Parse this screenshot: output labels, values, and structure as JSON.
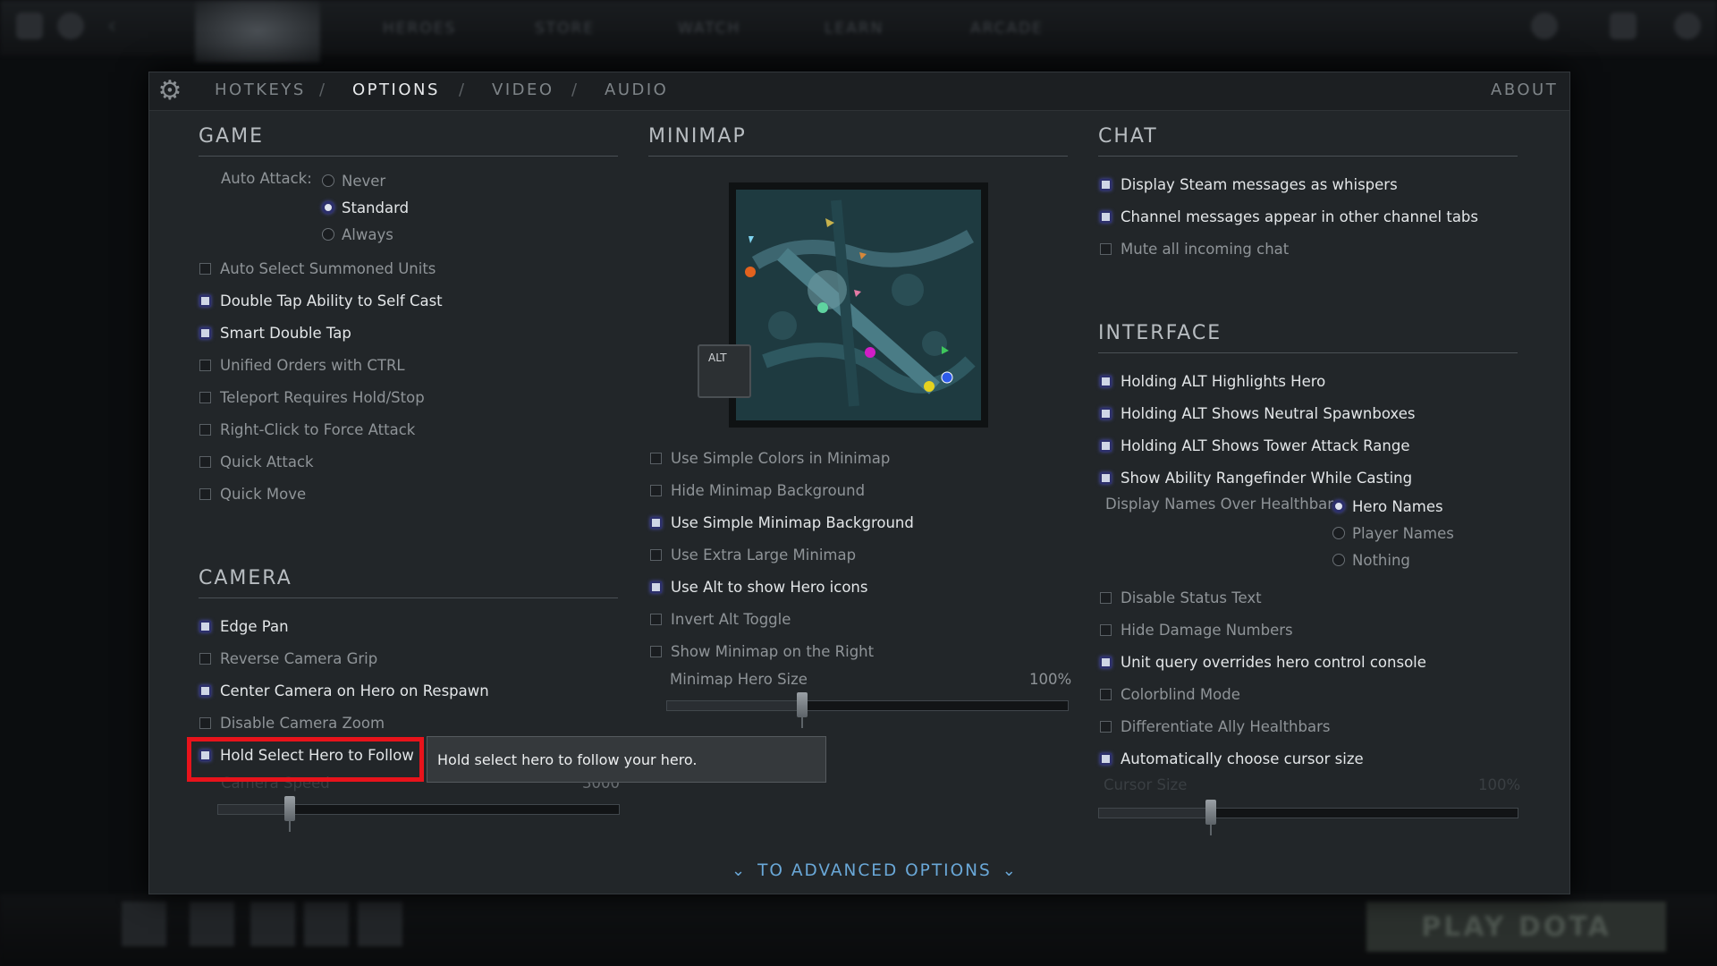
{
  "background": {
    "nav": [
      "HEROES",
      "STORE",
      "WATCH",
      "LEARN",
      "ARCADE"
    ],
    "play_button": "PLAY DOTA"
  },
  "tabs": {
    "hotkeys": "HOTKEYS",
    "options": "OPTIONS",
    "video": "VIDEO",
    "audio": "AUDIO",
    "separator": "/",
    "about": "ABOUT"
  },
  "game": {
    "title": "GAME",
    "auto_attack_label": "Auto Attack:",
    "auto_attack_options": [
      {
        "label": "Never",
        "selected": false
      },
      {
        "label": "Standard",
        "selected": true
      },
      {
        "label": "Always",
        "selected": false
      }
    ],
    "options": [
      {
        "label": "Auto Select Summoned Units",
        "checked": false
      },
      {
        "label": "Double Tap Ability to Self Cast",
        "checked": true
      },
      {
        "label": "Smart Double Tap",
        "checked": true
      },
      {
        "label": "Unified Orders with CTRL",
        "checked": false
      },
      {
        "label": "Teleport Requires Hold/Stop",
        "checked": false
      },
      {
        "label": "Right-Click to Force Attack",
        "checked": false
      },
      {
        "label": "Quick Attack",
        "checked": false
      },
      {
        "label": "Quick Move",
        "checked": false
      }
    ]
  },
  "camera": {
    "title": "CAMERA",
    "options": [
      {
        "label": "Edge Pan",
        "checked": true
      },
      {
        "label": "Reverse Camera Grip",
        "checked": false
      },
      {
        "label": "Center Camera on Hero on Respawn",
        "checked": true
      },
      {
        "label": "Disable Camera Zoom",
        "checked": false
      },
      {
        "label": "Hold Select Hero to Follow",
        "checked": true
      }
    ],
    "speed_label": "Camera Speed",
    "speed_value": "3000",
    "speed_fraction": 0.18
  },
  "minimap": {
    "title": "MINIMAP",
    "alt_key": "ALT",
    "options": [
      {
        "label": "Use Simple Colors in Minimap",
        "checked": false
      },
      {
        "label": "Hide Minimap Background",
        "checked": false
      },
      {
        "label": "Use Simple Minimap Background",
        "checked": true
      },
      {
        "label": "Use Extra Large Minimap",
        "checked": false
      },
      {
        "label": "Use Alt to show Hero icons",
        "checked": true
      },
      {
        "label": "Invert Alt Toggle",
        "checked": false
      },
      {
        "label": "Show Minimap on the Right",
        "checked": false
      }
    ],
    "hero_size_label": "Minimap Hero Size",
    "hero_size_value": "100%",
    "hero_size_fraction": 0.34
  },
  "chat": {
    "title": "CHAT",
    "options": [
      {
        "label": "Display Steam messages as whispers",
        "checked": true
      },
      {
        "label": "Channel messages appear in other channel tabs",
        "checked": true
      },
      {
        "label": "Mute all incoming chat",
        "checked": false
      }
    ]
  },
  "interface": {
    "title": "INTERFACE",
    "options_top": [
      {
        "label": "Holding ALT Highlights Hero",
        "checked": true
      },
      {
        "label": "Holding ALT Shows Neutral Spawnboxes",
        "checked": true
      },
      {
        "label": "Holding ALT Shows Tower Attack Range",
        "checked": true
      },
      {
        "label": "Show Ability Rangefinder While Casting",
        "checked": true
      }
    ],
    "display_names_label": "Display Names Over Healthbar",
    "display_names_options": [
      {
        "label": "Hero Names",
        "selected": true
      },
      {
        "label": "Player Names",
        "selected": false
      },
      {
        "label": "Nothing",
        "selected": false
      }
    ],
    "options_bottom": [
      {
        "label": "Disable Status Text",
        "checked": false
      },
      {
        "label": "Hide Damage Numbers",
        "checked": false
      },
      {
        "label": "Unit query overrides hero control console",
        "checked": true
      },
      {
        "label": "Colorblind Mode",
        "checked": false
      },
      {
        "label": "Differentiate Ally Healthbars",
        "checked": false
      },
      {
        "label": "Automatically choose cursor size",
        "checked": true
      }
    ],
    "cursor_size_label": "Cursor Size",
    "cursor_size_value": "100%",
    "cursor_size_fraction": 0.27
  },
  "tooltip": {
    "text": "Hold select hero to follow your hero."
  },
  "advanced": {
    "label": "TO ADVANCED OPTIONS"
  }
}
